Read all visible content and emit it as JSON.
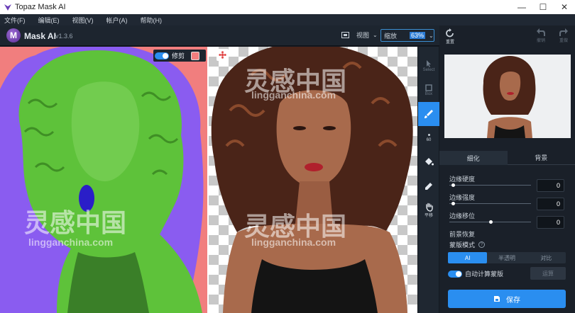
{
  "window": {
    "title": "Topaz Mask AI",
    "minimize": "—",
    "maximize": "☐",
    "close": "✕"
  },
  "menu": [
    "文件(F)",
    "编辑(E)",
    "视图(V)",
    "帐户(A)",
    "帮助(H)"
  ],
  "app": {
    "logo_letter": "M",
    "name": "Mask AI",
    "version": "v1.3.6"
  },
  "toolbar": {
    "view_label": "视图",
    "zoom_label": "缩放",
    "zoom_value": "63%"
  },
  "left_view": {
    "trim_label": "修剪",
    "trim_enabled": true
  },
  "tools": [
    {
      "name": "select",
      "label": "Select",
      "active": false
    },
    {
      "name": "box",
      "label": "Box",
      "active": false
    },
    {
      "name": "brush",
      "label": "",
      "active": true
    },
    {
      "name": "brush-size",
      "label": "60",
      "active": false
    },
    {
      "name": "fill",
      "label": "",
      "active": false
    },
    {
      "name": "picker",
      "label": "",
      "active": false
    },
    {
      "name": "pan",
      "label": "平移",
      "active": false
    }
  ],
  "actions": {
    "reset": "重置",
    "undo": "撤销",
    "redo": "重做"
  },
  "tabs": {
    "refine": "细化",
    "background": "背景"
  },
  "sliders": [
    {
      "label": "边缘硬度",
      "value": "0",
      "level": 0.04
    },
    {
      "label": "边缘强度",
      "value": "0",
      "level": 0.04
    },
    {
      "label": "边缘移位",
      "value": "0",
      "level": 0.5
    },
    {
      "label": "前景恢复",
      "value": "",
      "level": 0
    }
  ],
  "mask_mode": {
    "label": "蒙版模式",
    "options": [
      "AI",
      "半透明",
      "对比"
    ],
    "selected": "AI"
  },
  "auto_compute": {
    "label": "自动计算蒙版",
    "enabled": true,
    "button": "运算"
  },
  "save_label": "保存",
  "watermarks": [
    {
      "cn": "灵感中国",
      "en": "lingganchina.com"
    }
  ],
  "colors": {
    "accent": "#2a8ef0",
    "mask_keep": "#5ec23a",
    "mask_edge": "#8a5cf0",
    "mask_cut": "#f17e7e",
    "brush_stroke": "#2a1ec8"
  }
}
